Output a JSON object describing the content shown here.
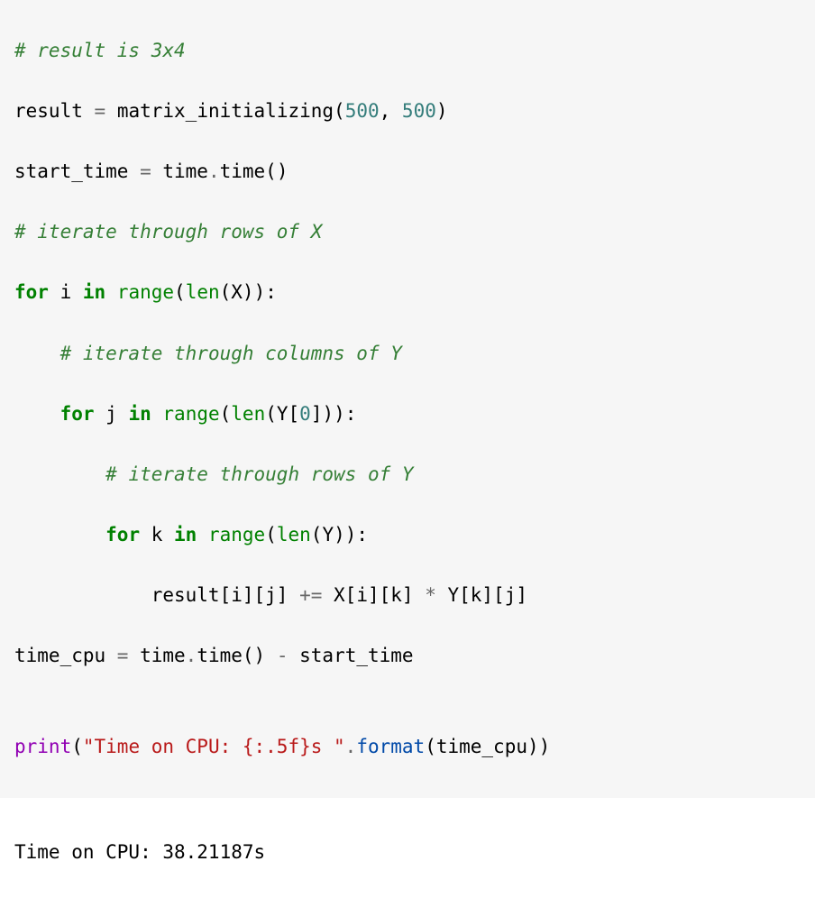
{
  "code": {
    "l1_comment": "# result is 3x4",
    "l2_a": "result ",
    "l2_op": "=",
    "l2_b": " matrix_initializing(",
    "l2_n1": "500",
    "l2_c": ", ",
    "l2_n2": "500",
    "l2_d": ")",
    "l3_a": "start_time ",
    "l3_op": "=",
    "l3_b": " time",
    "l3_dot": ".",
    "l3_c": "time()",
    "l4_comment": "# iterate through rows of X",
    "l5_for": "for",
    "l5_a": " i ",
    "l5_in": "in",
    "l5_b": " ",
    "l5_range": "range",
    "l5_c": "(",
    "l5_len": "len",
    "l5_d": "(X)):",
    "l6_indent": "    ",
    "l6_comment": "# iterate through columns of Y",
    "l7_indent": "    ",
    "l7_for": "for",
    "l7_a": " j ",
    "l7_in": "in",
    "l7_b": " ",
    "l7_range": "range",
    "l7_c": "(",
    "l7_len": "len",
    "l7_d": "(Y[",
    "l7_num": "0",
    "l7_e": "])):",
    "l8_indent": "        ",
    "l8_comment": "# iterate through rows of Y",
    "l9_indent": "        ",
    "l9_for": "for",
    "l9_a": " k ",
    "l9_in": "in",
    "l9_b": " ",
    "l9_range": "range",
    "l9_c": "(",
    "l9_len": "len",
    "l9_d": "(Y)):",
    "l10_indent": "            ",
    "l10_a": "result[i][j] ",
    "l10_op": "+=",
    "l10_b": " X[i][k] ",
    "l10_op2": "*",
    "l10_c": " Y[k][j]",
    "l11_a": "time_cpu ",
    "l11_op": "=",
    "l11_b": " time",
    "l11_dot": ".",
    "l11_c": "time() ",
    "l11_op2": "-",
    "l11_d": " start_time",
    "l12_blank": "",
    "l13_print": "print",
    "l13_a": "(",
    "l13_str": "\"Time on CPU: {:.5f}s \"",
    "l13_dot": ".",
    "l13_fmt": "format",
    "l13_b": "(time_cpu))"
  },
  "output": {
    "line1": "Time on CPU: 38.21187s "
  }
}
